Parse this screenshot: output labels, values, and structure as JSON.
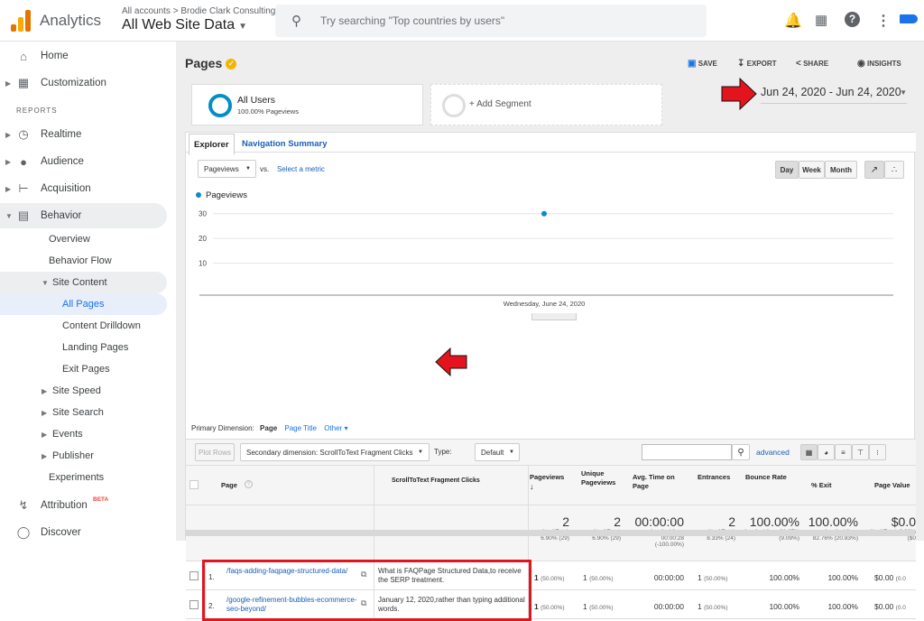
{
  "topbar": {
    "app_name": "Analytics",
    "breadcrumb": "All accounts > Brodie Clark Consulting",
    "view_name": "All Web Site Data",
    "search_placeholder": "Try searching \"Top countries by users\""
  },
  "sidebar": {
    "items": [
      {
        "label": "Home",
        "icon": "home-icon"
      },
      {
        "label": "Customization",
        "icon": "dashboard-icon"
      },
      {
        "label": "Realtime",
        "icon": "clock-icon"
      },
      {
        "label": "Audience",
        "icon": "person-icon"
      },
      {
        "label": "Acquisition",
        "icon": "acquisition-icon"
      },
      {
        "label": "Behavior",
        "icon": "behavior-icon"
      }
    ],
    "reports_label": "REPORTS",
    "behavior_sub": [
      "Overview",
      "Behavior Flow",
      "Site Content",
      "All Pages",
      "Content Drilldown",
      "Landing Pages",
      "Exit Pages",
      "Site Speed",
      "Site Search",
      "Events",
      "Publisher",
      "Experiments"
    ],
    "attribution": "Attribution",
    "beta": "BETA",
    "discover": "Discover"
  },
  "page": {
    "title": "Pages",
    "save": "SAVE",
    "export": "EXPORT",
    "share": "SHARE",
    "insights": "INSIGHTS"
  },
  "segments": {
    "all_users": "All Users",
    "all_users_sub": "100.00% Pageviews",
    "add_segment": "+ Add Segment"
  },
  "date_range": "Jun 24, 2020 - Jun 24, 2020",
  "tabs": {
    "explorer": "Explorer",
    "nav_summary": "Navigation Summary"
  },
  "chart_controls": {
    "metric": "Pageviews",
    "vs": "vs.",
    "select_metric": "Select a metric",
    "day": "Day",
    "week": "Week",
    "month": "Month"
  },
  "chart_data": {
    "type": "line",
    "series": [
      {
        "name": "Pageviews",
        "values": [
          30
        ]
      }
    ],
    "x": [
      "Wednesday, June 24, 2020"
    ],
    "yticks": [
      30,
      20,
      10
    ],
    "ylim": [
      0,
      35
    ],
    "xlabel": "Wednesday, June 24, 2020",
    "color": "#058dc7"
  },
  "dimension": {
    "label": "Primary Dimension:",
    "page": "Page",
    "page_title": "Page Title",
    "other": "Other"
  },
  "table_bar": {
    "plot_rows": "Plot Rows",
    "secondary": "Secondary dimension: ScrollToText Fragment Clicks",
    "type_label": "Type:",
    "type_value": "Default",
    "advanced": "advanced"
  },
  "table": {
    "headers": [
      "Page",
      "ScrollToText Fragment Clicks",
      "Pageviews",
      "Unique Pageviews",
      "Avg. Time on Page",
      "Entrances",
      "Bounce Rate",
      "% Exit",
      "Page Value"
    ],
    "totals": {
      "pageviews": "2",
      "pageviews_sub": "% of Total: 6.90% (29)",
      "unique": "2",
      "unique_sub": "% of Total: 6.90% (29)",
      "avgtime": "00:00:00",
      "avgtime_sub": "Avg for View: 00:00:28 (-100.00%)",
      "entrances": "2",
      "entrances_sub": "% of Total: 8.33% (24)",
      "bounce": "100.00%",
      "bounce_sub": "Avg for View: 91.67% (9.09%)",
      "exit": "100.00%",
      "exit_sub": "Avg for View: 82.76% (20.83%)",
      "value": "$0.0",
      "value_sub": "% of Total: 0.00% ($0"
    },
    "rows": [
      {
        "num": "1.",
        "page": "/faqs-adding-faqpage-structured-data/",
        "stf": "What is FAQPage Structured Data,to receive the SERP treatment.",
        "pv": "1",
        "pv_pct": "(50.00%)",
        "upv": "1",
        "upv_pct": "(50.00%)",
        "time": "00:00:00",
        "ent": "1",
        "ent_pct": "(50.00%)",
        "bounce": "100.00%",
        "exit": "100.00%",
        "value": "$0.00",
        "value_pct": "(0.0"
      },
      {
        "num": "2.",
        "page": "/google-refinement-bubbles-ecommerce-seo-beyond/",
        "stf": "January 12, 2020,rather than typing additional words.",
        "pv": "1",
        "pv_pct": "(50.00%)",
        "upv": "1",
        "upv_pct": "(50.00%)",
        "time": "00:00:00",
        "ent": "1",
        "ent_pct": "(50.00%)",
        "bounce": "100.00%",
        "exit": "100.00%",
        "value": "$0.00",
        "value_pct": "(0.0"
      }
    ]
  }
}
